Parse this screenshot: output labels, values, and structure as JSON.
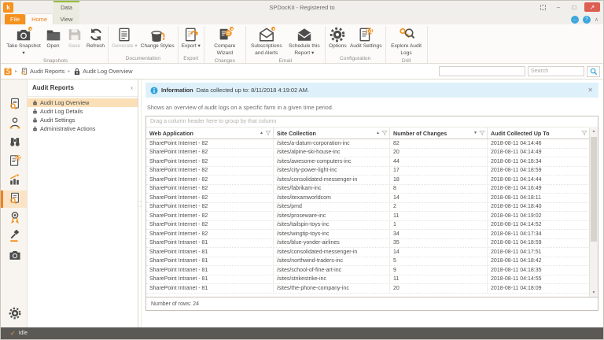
{
  "window": {
    "title": "SPDocKit - Registered to",
    "contextual_tab_group": "Data",
    "tabs": {
      "file": "File",
      "home": "Home",
      "view": "View"
    },
    "window_buttons": [
      {
        "name": "fit-screen"
      },
      {
        "name": "minimize"
      },
      {
        "name": "maximize"
      },
      {
        "name": "close"
      }
    ],
    "helper_buttons": [
      {
        "name": "feedback"
      },
      {
        "name": "help"
      },
      {
        "name": "collapse-ribbon"
      }
    ]
  },
  "ribbon": {
    "groups": [
      {
        "label": "Snapshots",
        "buttons": [
          {
            "label": "Take Snapshot",
            "icon": "camera",
            "dropdown": true,
            "badge": true
          },
          {
            "label": "Open",
            "icon": "folder"
          },
          {
            "label": "Save",
            "icon": "floppy",
            "disabled": true
          },
          {
            "label": "Refresh",
            "icon": "refresh"
          }
        ]
      },
      {
        "label": "Documentation",
        "buttons": [
          {
            "label": "Generate",
            "icon": "doc",
            "dropdown": true,
            "disabled": true
          },
          {
            "label": "Change Styles",
            "icon": "paint"
          }
        ]
      },
      {
        "label": "Export",
        "buttons": [
          {
            "label": "Export",
            "icon": "doc-export",
            "dropdown": true
          }
        ]
      },
      {
        "label": "Changes",
        "buttons": [
          {
            "label": "Compare Wizard",
            "icon": "doc-compare",
            "badge": true
          }
        ]
      },
      {
        "label": "Email",
        "buttons": [
          {
            "label": "Subscriptions and Alerts",
            "icon": "mail-open",
            "badge": true
          },
          {
            "label": "Schedule this Report",
            "icon": "mail-solid",
            "dropdown": true
          }
        ]
      },
      {
        "label": "Configuration",
        "buttons": [
          {
            "label": "Options",
            "icon": "gear"
          },
          {
            "label": "Audit Settings",
            "icon": "doc-gear"
          }
        ]
      },
      {
        "label": "Drill",
        "buttons": [
          {
            "label": "Explore Audit Logs",
            "icon": "key-search"
          }
        ]
      }
    ]
  },
  "breadcrumb": {
    "items": [
      {
        "icon": "app"
      },
      {
        "icon": "doc-search",
        "label": "Audit Reports"
      },
      {
        "icon": "lock",
        "label": "Audit Log Overview"
      }
    ]
  },
  "search": {
    "placeholder": "Search"
  },
  "sidebar_rail": {
    "active_index": 5,
    "items": [
      "doc-search",
      "user",
      "binoculars",
      "doc-gear",
      "chart",
      "doc-search",
      "award",
      "gavel",
      "camera"
    ],
    "bottom_item": "gear"
  },
  "nav_panel": {
    "title": "Audit Reports",
    "items": [
      {
        "label": "Audit Log Overview",
        "active": true
      },
      {
        "label": "Audit Log Details"
      },
      {
        "label": "Audit Settings"
      },
      {
        "label": "Administrative Actions"
      }
    ]
  },
  "info_bar": {
    "title": "Information",
    "text": "Data collected up to: 8/11/2018 4:19:02 AM."
  },
  "description": "Shows an overview of audit logs on a specific farm in a given time period.",
  "grid": {
    "group_hint": "Drag a column header here to group by that column",
    "columns": [
      {
        "label": "Web Application",
        "sort": "asc"
      },
      {
        "label": "Site Collection",
        "sort": "asc"
      },
      {
        "label": "Number of Changes",
        "sort": "desc"
      },
      {
        "label": "Audit Collected Up To"
      }
    ],
    "rows": [
      [
        "SharePoint Internet - 82",
        "/sites/a-datum-corporation-inc",
        "82",
        "2018-08-11 04:14:46"
      ],
      [
        "SharePoint Internet - 82",
        "/sites/alpine-ski-house-inc",
        "20",
        "2018-08-11 04:14:49"
      ],
      [
        "SharePoint Internet - 82",
        "/sites/awesome-computers-inc",
        "44",
        "2018-08-11 04:18:34"
      ],
      [
        "SharePoint Internet - 82",
        "/sites/city-power-light-inc",
        "17",
        "2018-08-11 04:18:59"
      ],
      [
        "SharePoint Internet - 82",
        "/sites/consolidated-messenger-in",
        "18",
        "2018-08-11 04:14:44"
      ],
      [
        "SharePoint Internet - 82",
        "/sites/fabrikam-inc",
        "8",
        "2018-08-11 04:16:49"
      ],
      [
        "SharePoint Internet - 82",
        "/sites/itexamworldcom",
        "14",
        "2018-08-11 04:18:11"
      ],
      [
        "SharePoint Internet - 82",
        "/sites/pmd",
        "2",
        "2018-08-11 04:18:40"
      ],
      [
        "SharePoint Internet - 82",
        "/sites/proseware-inc",
        "11",
        "2018-08-11 04:19:02"
      ],
      [
        "SharePoint Internet - 82",
        "/sites/tailspin-toys-inc",
        "1",
        "2018-08-11 04:14:52"
      ],
      [
        "SharePoint Internet - 82",
        "/sites/wingtip-toys-inc",
        "34",
        "2018-08-11 04:17:34"
      ],
      [
        "SharePoint Intranet - 81",
        "/sites/blue-yonder-airlines",
        "35",
        "2018-08-11 04:18:59"
      ],
      [
        "SharePoint Intranet - 81",
        "/sites/consolidated-messenger-in",
        "14",
        "2018-08-11 04:17:51"
      ],
      [
        "SharePoint Intranet - 81",
        "/sites/northwind-traders-inc",
        "5",
        "2018-08-11 04:18:42"
      ],
      [
        "SharePoint Intranet - 81",
        "/sites/school-of-fine-art-inc",
        "9",
        "2018-08-11 04:18:35"
      ],
      [
        "SharePoint Intranet - 81",
        "/sites/strikestrike-inc",
        "11",
        "2018-08-11 04:14:55"
      ],
      [
        "SharePoint Intranet - 81",
        "/sites/the-phone-company-inc",
        "20",
        "2018-08-11 04:18:09"
      ]
    ],
    "footer": "Number of rows: 24"
  },
  "status_bar": {
    "text": "Idle"
  }
}
